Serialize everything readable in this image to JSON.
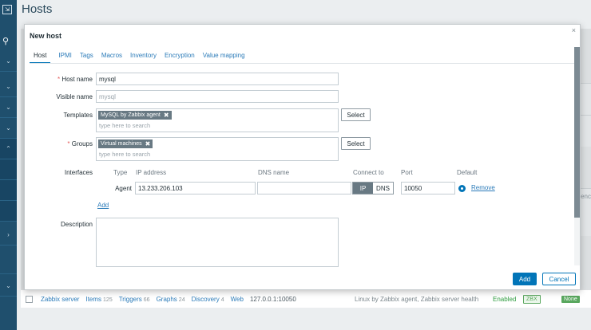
{
  "background": {
    "page_title": "Hosts",
    "right_clip_text": "enc",
    "host_row": {
      "name": "Zabbix server",
      "items_label": "Items",
      "items_count": "125",
      "triggers_label": "Triggers",
      "triggers_count": "66",
      "graphs_label": "Graphs",
      "graphs_count": "24",
      "discovery_label": "Discovery",
      "discovery_count": "4",
      "web_label": "Web",
      "interface": "127.0.0.1:10050",
      "templates": "Linux by Zabbix agent, Zabbix server health",
      "status": "Enabled",
      "availability": "ZBX",
      "encryption": "None"
    }
  },
  "modal": {
    "title": "New host",
    "close_glyph": "×",
    "tabs": [
      "Host",
      "IPMI",
      "Tags",
      "Macros",
      "Inventory",
      "Encryption",
      "Value mapping"
    ],
    "active_tab": "Host",
    "form": {
      "host_name_label": "Host name",
      "host_name_value": "mysql",
      "visible_name_label": "Visible name",
      "visible_name_placeholder": "mysql",
      "templates_label": "Templates",
      "templates_chip": "MySQL by Zabbix agent",
      "templates_placeholder": "type here to search",
      "groups_label": "Groups",
      "groups_chip": "Virtual machines",
      "groups_placeholder": "type here to search",
      "select_label": "Select",
      "interfaces_label": "Interfaces",
      "iface_headers": {
        "type": "Type",
        "ip": "IP address",
        "dns": "DNS name",
        "connect": "Connect to",
        "port": "Port",
        "default": "Default"
      },
      "iface_row": {
        "type": "Agent",
        "ip": "13.233.206.103",
        "dns": "",
        "connect_ip": "IP",
        "connect_dns": "DNS",
        "port": "10050",
        "remove": "Remove"
      },
      "add_link": "Add",
      "description_label": "Description",
      "description_value": ""
    },
    "footer": {
      "add_label": "Add",
      "cancel_label": "Cancel"
    }
  },
  "colors": {
    "accent": "#0275b8",
    "sidebar": "#1f4f6d",
    "chip": "#687983",
    "required": "#e45959",
    "enabled": "#2e9c3f"
  }
}
